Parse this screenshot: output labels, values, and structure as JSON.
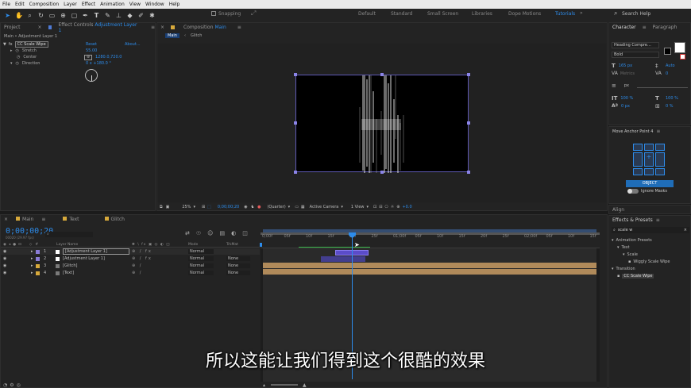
{
  "menu": [
    "File",
    "Edit",
    "Composition",
    "Layer",
    "Effect",
    "Animation",
    "View",
    "Window",
    "Help"
  ],
  "toolbar": {
    "snapping_label": "Snapping",
    "workspaces": [
      "Default",
      "Standard",
      "Small Screen",
      "Libraries",
      "Dope Motions",
      "Tutorials"
    ],
    "active_workspace": "Tutorials",
    "search_placeholder": "Search Help"
  },
  "project_panel": {
    "tabs": [
      "Project",
      "Effect Controls"
    ],
    "effect_controls_layer": "Adjustment Layer 1",
    "breadcrumb": "Main • Adjustment Layer 1",
    "effect": {
      "name": "CC Scale Wipe",
      "reset": "Reset",
      "about": "About..."
    },
    "params": [
      {
        "name": "Stretch",
        "value": "55.00"
      },
      {
        "name": "Center",
        "value": "1280.0,720.0"
      },
      {
        "name": "Direction",
        "value": "0 x +180.0 °"
      }
    ]
  },
  "composition": {
    "tab_label": "Composition",
    "comp_name": "Main",
    "flow_items": [
      "Main",
      "Glitch"
    ],
    "zoom": "25%",
    "timecode": "0;00;00;20",
    "resolution": "(Quarter)",
    "camera": "Active Camera",
    "view": "1 View",
    "exposure": "+0.0"
  },
  "character_panel": {
    "tabs": [
      "Character",
      "Paragraph"
    ],
    "font": "Heading Compre...",
    "style": "Bold",
    "font_size": "165 px",
    "leading": "Auto",
    "kerning": "Metrics",
    "tracking": "0",
    "stroke_unit": "px",
    "vscale": "100 %",
    "hscale": "100 %",
    "baseline": "0 px",
    "tsume": "0 %"
  },
  "anchor_panel": {
    "title": "Move Anchor Point 4",
    "object_button": "OBJECT",
    "ignore_masks": "Ignore Masks"
  },
  "align_panel": {
    "title": "Align"
  },
  "effects_presets": {
    "title": "Effects & Presets",
    "search": "scale w",
    "tree": [
      {
        "label": "Animation Presets",
        "level": 0
      },
      {
        "label": "Text",
        "level": 1
      },
      {
        "label": "Scale",
        "level": 2
      },
      {
        "label": "Wiggly Scale Wipe",
        "level": 3
      },
      {
        "label": "Transition",
        "level": 0
      },
      {
        "label": "CC Scale Wipe",
        "level": 1
      }
    ]
  },
  "timeline": {
    "tabs": [
      {
        "label": "Main",
        "color": "#d7a93b"
      },
      {
        "label": "Text",
        "color": "#d7a93b"
      },
      {
        "label": "Glitch",
        "color": "#d7a93b"
      }
    ],
    "timecode": "0;00;00;20",
    "frame_info": "00020 (29.97 fps)",
    "columns": {
      "layer_name": "Layer Name",
      "mode": "Mode",
      "trkmat": "TrkMat"
    },
    "layers": [
      {
        "num": "1",
        "name": "[Adjustment Layer 1]",
        "mode": "Normal",
        "trkmat": "",
        "color": "#8a7cd6"
      },
      {
        "num": "2",
        "name": "[Adjustment Layer 1]",
        "mode": "Normal",
        "trkmat": "None",
        "color": "#8a7cd6"
      },
      {
        "num": "3",
        "name": "[Glitch]",
        "mode": "Normal",
        "trkmat": "None",
        "color": "#d7a93b"
      },
      {
        "num": "4",
        "name": "[Text]",
        "mode": "Normal",
        "trkmat": "None",
        "color": "#d7a93b"
      }
    ],
    "ruler": [
      "0;00f",
      "05f",
      "10f",
      "15f",
      "20f",
      "25f",
      "01;00f",
      "05f",
      "10f",
      "15f",
      "20f",
      "25f",
      "02;00f",
      "05f",
      "10f",
      "15f"
    ],
    "playhead_frame": 20
  },
  "subtitle": "所以这能让我们得到这个很酷的效果",
  "colors": {
    "accent": "#2d8ceb",
    "layer_tan": "#b08a5a",
    "layer_purple": "#6a5cd1",
    "work_area": "#2e5fa8"
  }
}
